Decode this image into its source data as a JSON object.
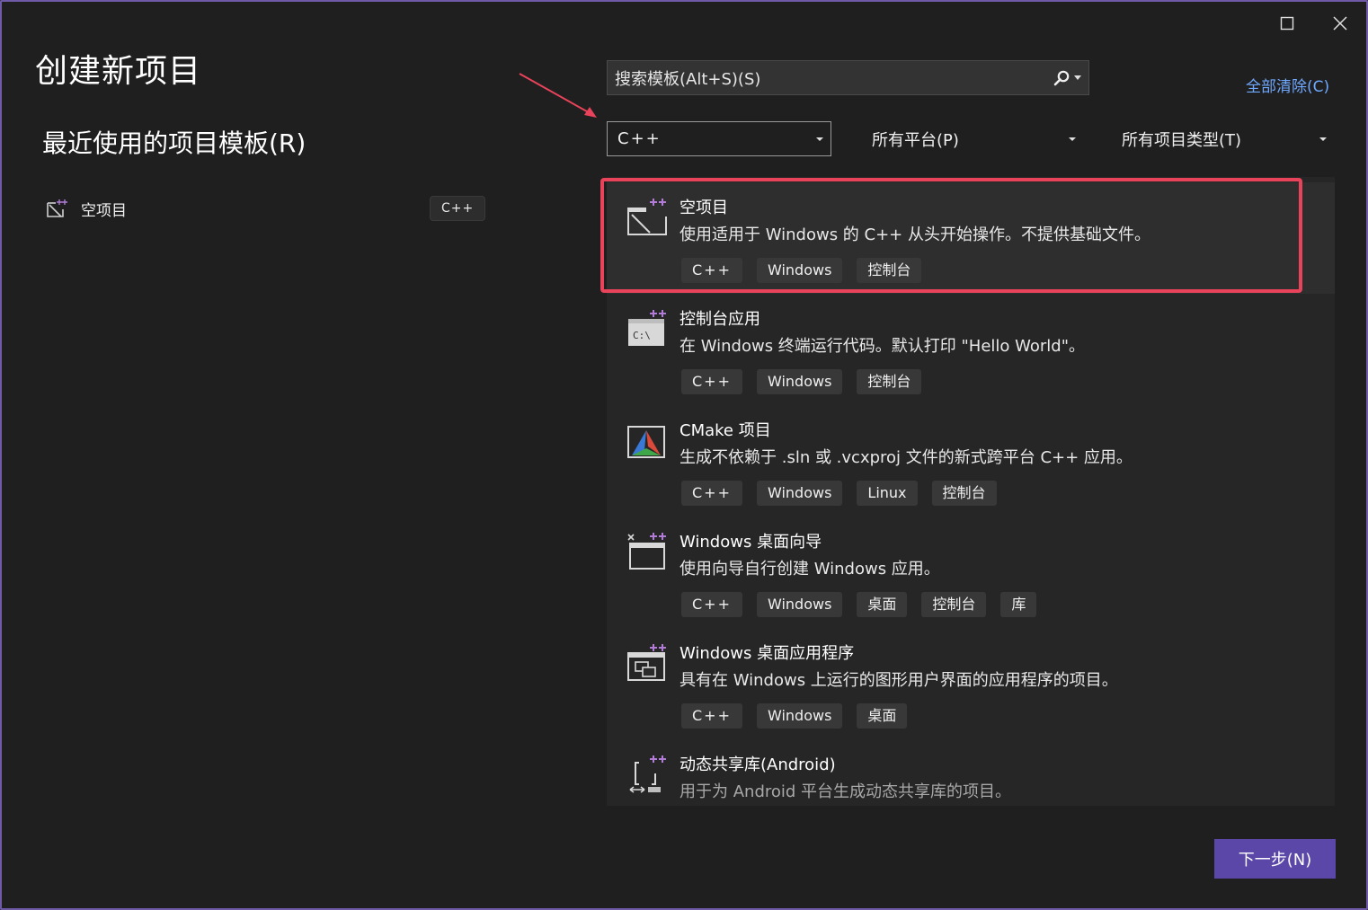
{
  "dialog": {
    "title": "创建新项目",
    "colors": {
      "accent": "#5a47a8",
      "link": "#6fa8ff",
      "highlight": "#e8435a",
      "border": "#6f5aa8"
    }
  },
  "window_controls": {
    "maximize_icon": "maximize-icon",
    "close_icon": "close-icon"
  },
  "recent": {
    "heading": "最近使用的项目模板(R)",
    "items": [
      {
        "label": "空项目",
        "tag": "C++"
      }
    ]
  },
  "search": {
    "placeholder": "搜索模板(Alt+S)(S)"
  },
  "clear_all": "全部清除(C)",
  "filters": {
    "language": "C++",
    "platform": "所有平台(P)",
    "project_type": "所有项目类型(T)"
  },
  "templates": [
    {
      "name": "空项目",
      "description": "使用适用于 Windows 的 C++ 从头开始操作。不提供基础文件。",
      "tags": [
        "C++",
        "Windows",
        "控制台"
      ],
      "icon": "empty-project-icon"
    },
    {
      "name": "控制台应用",
      "description": "在 Windows 终端运行代码。默认打印 \"Hello World\"。",
      "tags": [
        "C++",
        "Windows",
        "控制台"
      ],
      "icon": "console-app-icon"
    },
    {
      "name": "CMake 项目",
      "description": "生成不依赖于 .sln 或 .vcxproj 文件的新式跨平台 C++ 应用。",
      "tags": [
        "C++",
        "Windows",
        "Linux",
        "控制台"
      ],
      "icon": "cmake-icon"
    },
    {
      "name": "Windows 桌面向导",
      "description": "使用向导自行创建 Windows 应用。",
      "tags": [
        "C++",
        "Windows",
        "桌面",
        "控制台",
        "库"
      ],
      "icon": "desktop-wizard-icon"
    },
    {
      "name": "Windows 桌面应用程序",
      "description": "具有在 Windows 上运行的图形用户界面的应用程序的项目。",
      "tags": [
        "C++",
        "Windows",
        "桌面"
      ],
      "icon": "desktop-app-icon"
    },
    {
      "name": "动态共享库(Android)",
      "description": "用于为 Android 平台生成动态共享库的项目。",
      "tags": [],
      "icon": "android-library-icon"
    }
  ],
  "next_button": "下一步(N)"
}
